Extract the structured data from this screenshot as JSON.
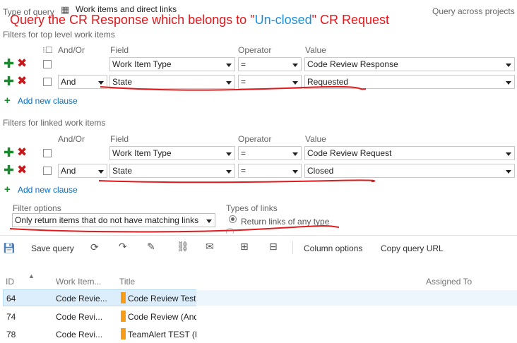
{
  "query_type": {
    "label": "Type of query",
    "value": "Work items and direct links"
  },
  "annotation": {
    "prefix": "Query the CR Response which belongs to ",
    "quote_open": "\"",
    "highlight": "Un-closed",
    "quote_close": "\"",
    "suffix": " CR Request"
  },
  "query_across_projects": "Query across projects",
  "top_section": {
    "title": "Filters for top level work items",
    "headers": {
      "andor": "And/Or",
      "field": "Field",
      "operator": "Operator",
      "value": "Value"
    },
    "rows": [
      {
        "andor": "",
        "field": "Work Item Type",
        "operator": "=",
        "value": "Code Review Response"
      },
      {
        "andor": "And",
        "field": "State",
        "operator": "=",
        "value": "Requested"
      }
    ],
    "add_clause": "Add new clause"
  },
  "linked_section": {
    "title": "Filters for linked work items",
    "headers": {
      "andor": "And/Or",
      "field": "Field",
      "operator": "Operator",
      "value": "Value"
    },
    "rows": [
      {
        "andor": "",
        "field": "Work Item Type",
        "operator": "=",
        "value": "Code Review Request"
      },
      {
        "andor": "And",
        "field": "State",
        "operator": "=",
        "value": "Closed"
      }
    ],
    "add_clause": "Add new clause"
  },
  "filter_options": {
    "label": "Filter options",
    "value": "Only return items that do not have matching links"
  },
  "types_of_links": {
    "label": "Types of links",
    "option": "Return links of any type"
  },
  "toolbar": {
    "save_query": "Save query",
    "column_options": "Column options",
    "copy_query_url": "Copy query URL"
  },
  "results": {
    "columns": {
      "id": "ID",
      "work_item_type": "Work Item...",
      "title": "Title",
      "assigned_to": "Assigned To"
    },
    "rows": [
      {
        "id": "64",
        "type": "Code Revie...",
        "title": "Code Review Test"
      },
      {
        "id": "74",
        "type": "Code Revi...",
        "title": "Code Review (And"
      },
      {
        "id": "78",
        "type": "Code Revi...",
        "title": "TeamAlert TEST (Li"
      }
    ]
  }
}
